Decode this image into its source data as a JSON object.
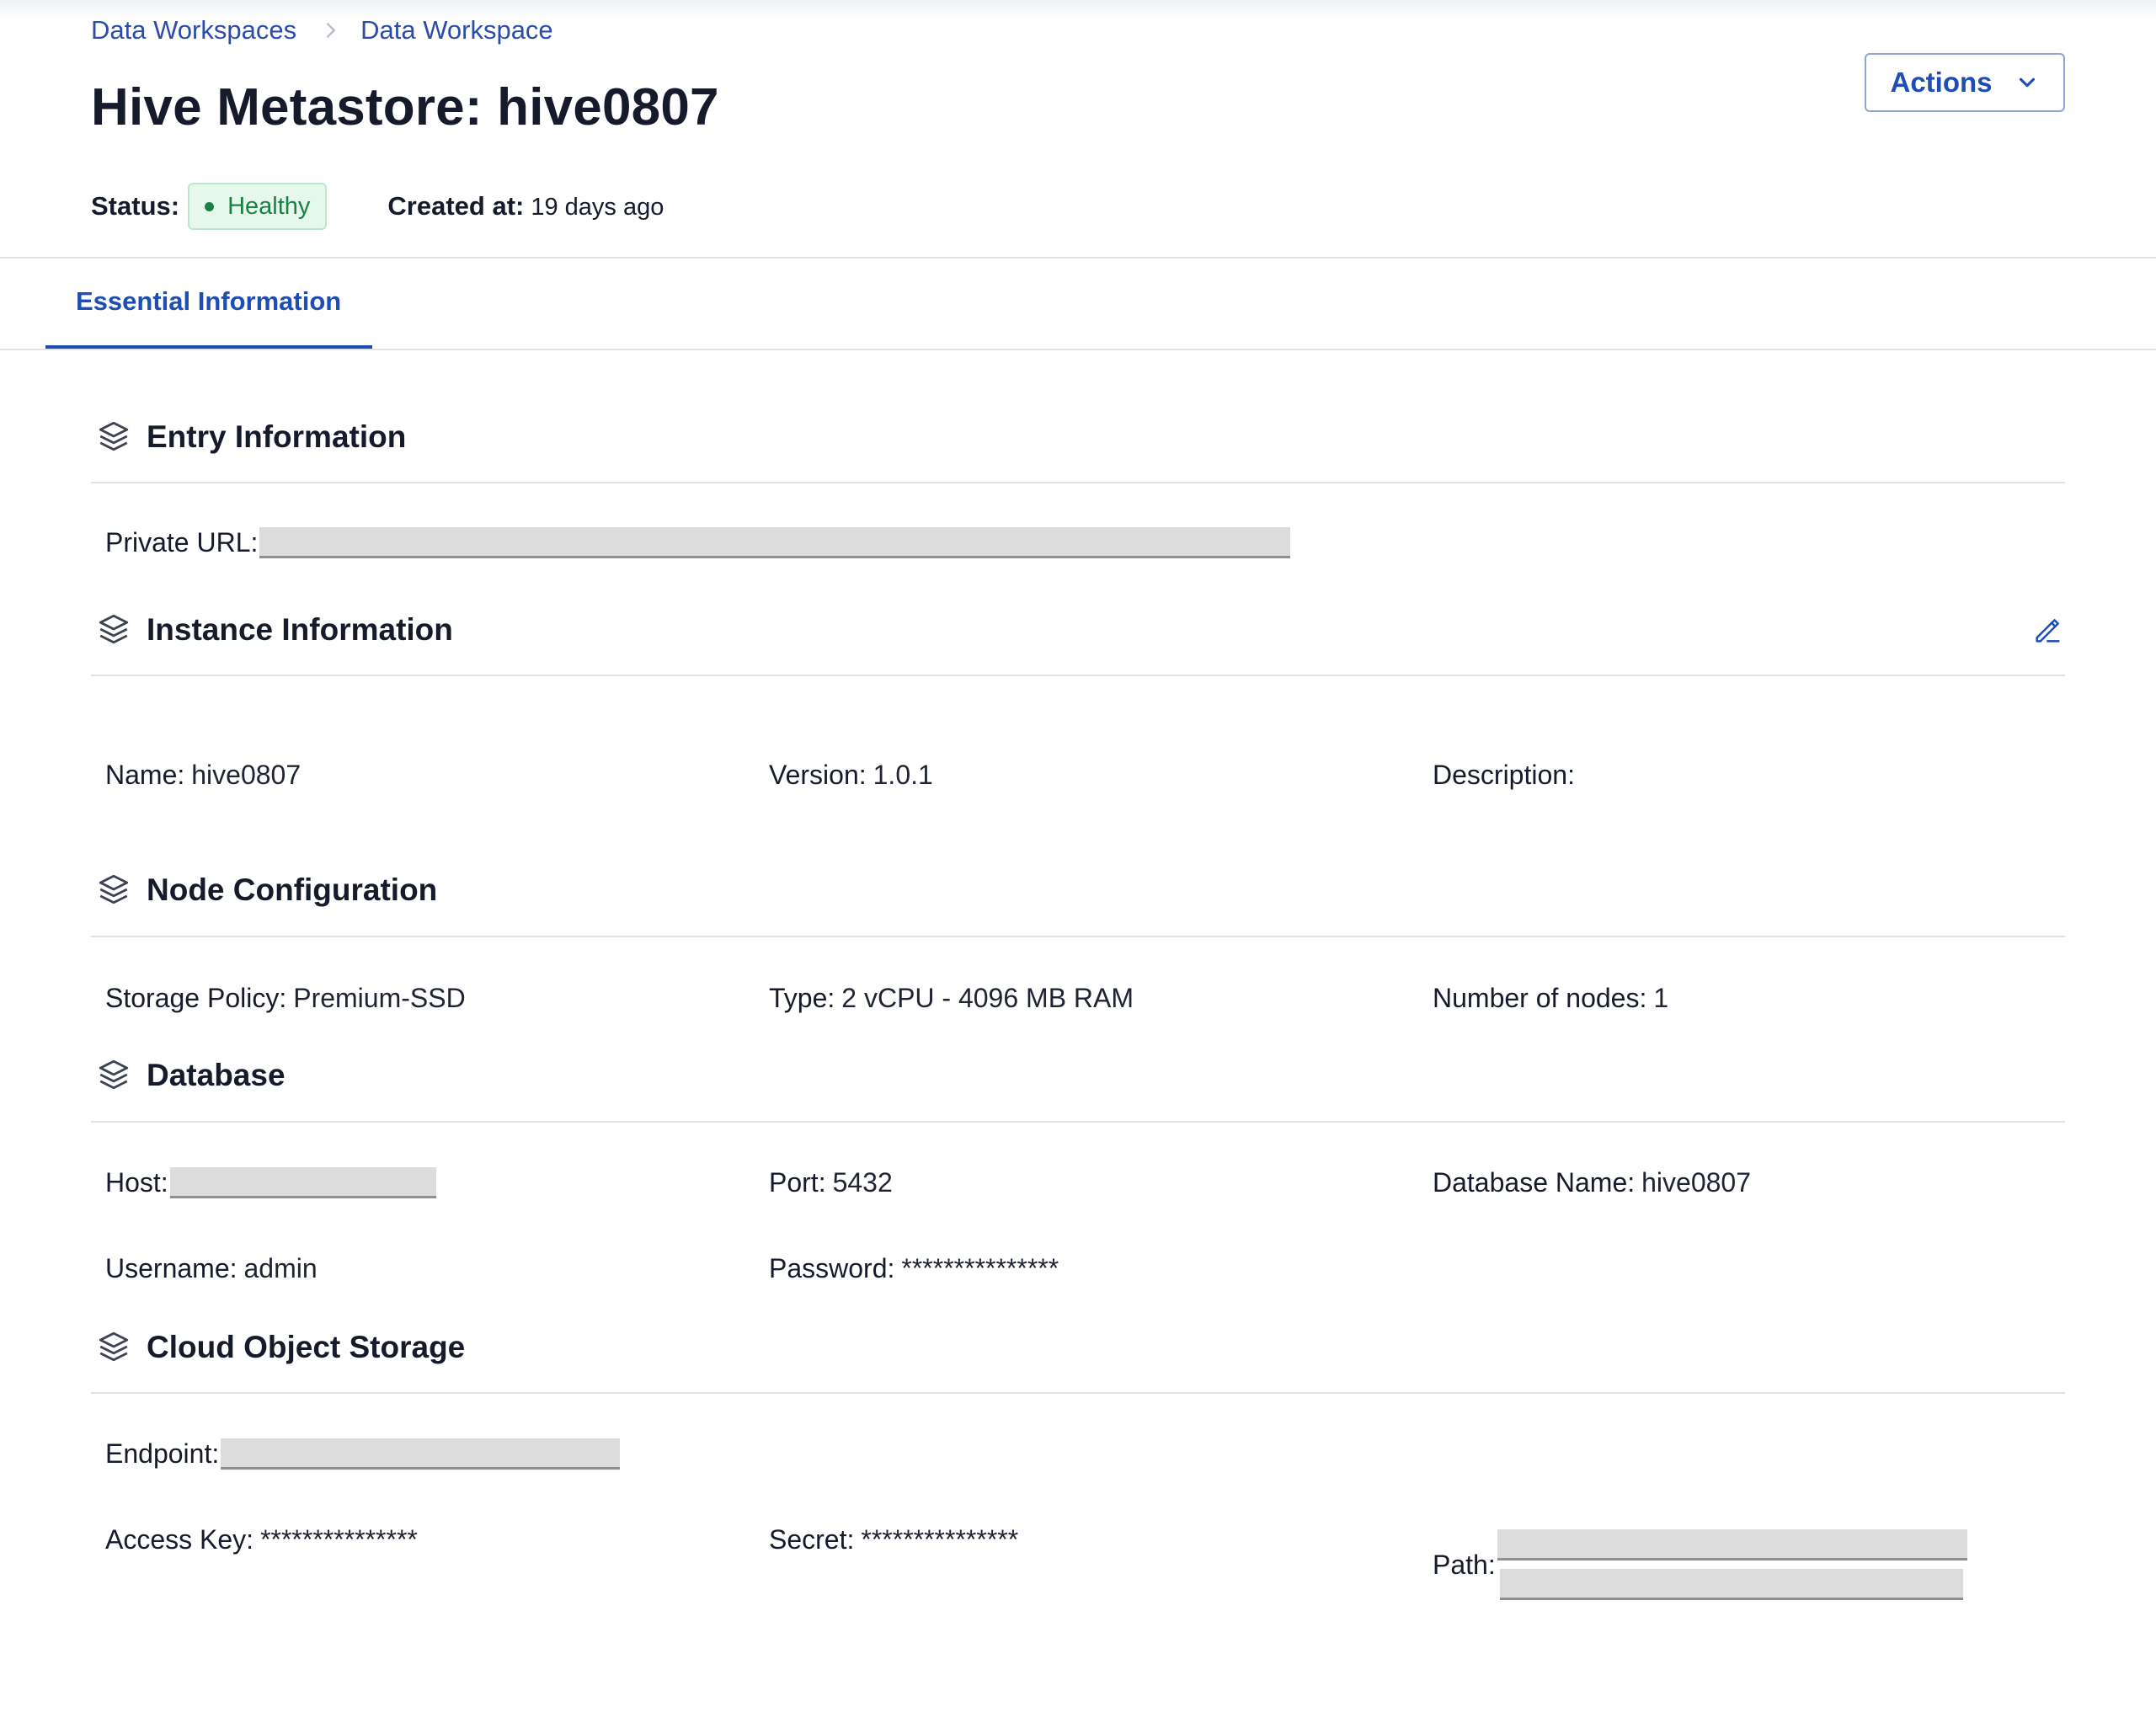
{
  "breadcrumb": {
    "items": [
      "Data Workspaces",
      "Data Workspace"
    ],
    "separator_icon": "chevron-right-icon"
  },
  "page": {
    "title": "Hive Metastore: hive0807",
    "status_label": "Status:",
    "status_value": "Healthy",
    "created_label": "Created at:",
    "created_value": "19 days ago"
  },
  "actions": {
    "label": "Actions",
    "icon": "chevron-down-icon"
  },
  "tabs": [
    {
      "label": "Essential Information",
      "active": true
    }
  ],
  "sections": {
    "entry": {
      "title": "Entry Information",
      "icon": "layers-icon",
      "private_url_label": "Private URL:"
    },
    "instance": {
      "title": "Instance Information",
      "icon": "layers-icon",
      "edit_icon": "pencil-icon",
      "name_label": "Name:",
      "name_value": "hive0807",
      "version_label": "Version:",
      "version_value": "1.0.1",
      "description_label": "Description:",
      "description_value": ""
    },
    "node": {
      "title": "Node Configuration",
      "icon": "layers-icon",
      "storage_label": "Storage Policy:",
      "storage_value": "Premium-SSD",
      "type_label": "Type:",
      "type_value": "2 vCPU - 4096 MB RAM",
      "nodes_label": "Number of nodes:",
      "nodes_value": "1"
    },
    "database": {
      "title": "Database",
      "icon": "layers-icon",
      "host_label": "Host:",
      "port_label": "Port:",
      "port_value": "5432",
      "dbname_label": "Database Name:",
      "dbname_value": "hive0807",
      "username_label": "Username:",
      "username_value": "admin",
      "password_label": "Password:",
      "password_value": "***************"
    },
    "storage": {
      "title": "Cloud Object Storage",
      "icon": "layers-icon",
      "endpoint_label": "Endpoint:",
      "access_label": "Access Key:",
      "access_value": "***************",
      "secret_label": "Secret:",
      "secret_value": "***************",
      "path_label": "Path:"
    }
  },
  "colors": {
    "accent": "#1e4db3",
    "link": "#2a4ea8",
    "healthy_text": "#1c8044",
    "healthy_bg": "#e6f8ec",
    "divider": "#dfe2e7",
    "redaction": "#dcdcdc"
  }
}
